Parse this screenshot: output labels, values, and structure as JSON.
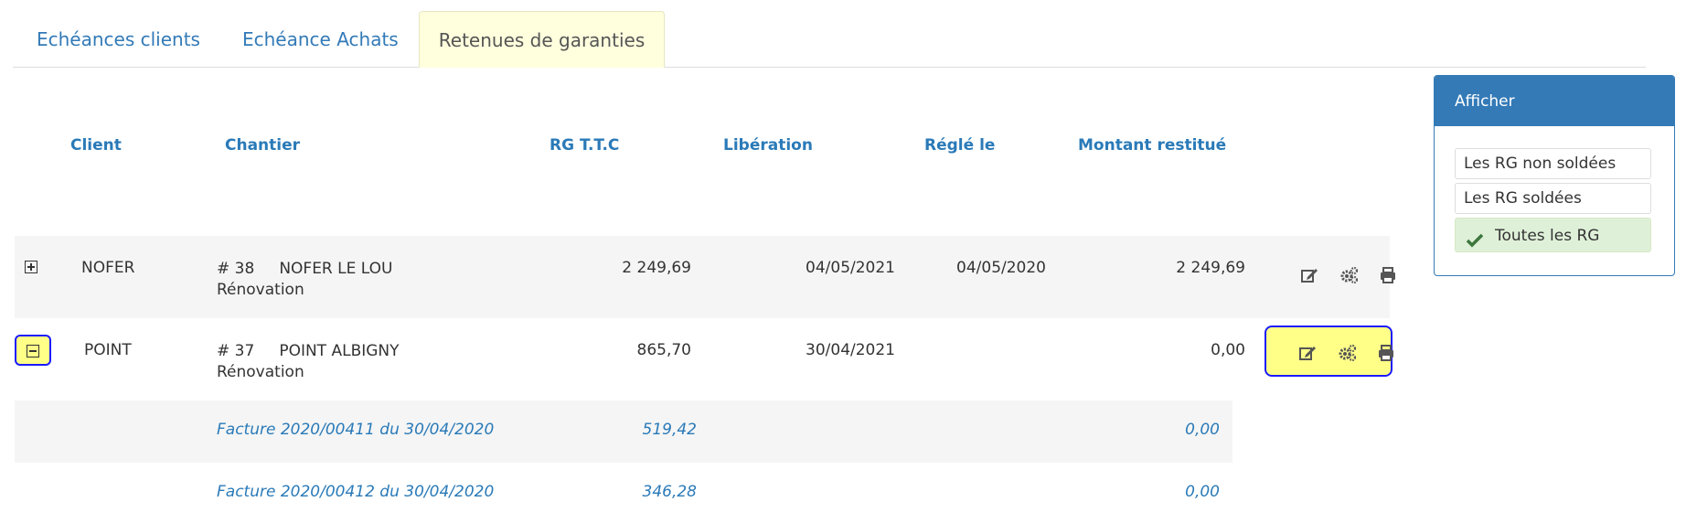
{
  "tabs": [
    "Echéances clients",
    "Echéance Achats",
    "Retenues de garanties"
  ],
  "columns": {
    "client": "Client",
    "chantier": "Chantier",
    "rg_ttc": "RG T.T.C",
    "liberation": "Libération",
    "regle_le": "Réglé le",
    "montant_restitue": "Montant restitué"
  },
  "rows": [
    {
      "client": "NOFER",
      "chantier_num": "#  38",
      "chantier_name": "NOFER LE LOU",
      "chantier_type": "Rénovation",
      "rg_ttc": "2 249,69",
      "liberation": "04/05/2021",
      "regle_le": "04/05/2020",
      "montant_restitue": "2 249,69",
      "expanded": false
    },
    {
      "client": "POINT",
      "chantier_num": "#  37",
      "chantier_name": "POINT ALBIGNY",
      "chantier_type": "Rénovation",
      "rg_ttc": "865,70",
      "liberation": "30/04/2021",
      "regle_le": "",
      "montant_restitue": "0,00",
      "expanded": true
    }
  ],
  "sub_rows": [
    {
      "facture": "Facture 2020/00411 du 30/04/2020",
      "rg_ttc": "519,42",
      "montant_restitue": "0,00"
    },
    {
      "facture": "Facture 2020/00412 du 30/04/2020",
      "rg_ttc": "346,28",
      "montant_restitue": "0,00"
    }
  ],
  "icons": {
    "expand": "plus-square-icon",
    "collapse": "minus-square-icon",
    "edit": "edit-icon",
    "settings": "gears-icon",
    "print": "print-icon",
    "check": "check-icon"
  },
  "filter_panel": {
    "title": "Afficher",
    "options": [
      "Les RG non soldées",
      "Les RG soldées",
      "Toutes les RG"
    ],
    "selected": "Toutes les RG"
  },
  "colors": {
    "link": "#337ab7",
    "active_tab_bg": "#ffffde",
    "highlight": "#ffff88",
    "highlight_border": "#1a1aff",
    "selected_option_bg": "#dff0d8",
    "check": "#3c763d"
  }
}
